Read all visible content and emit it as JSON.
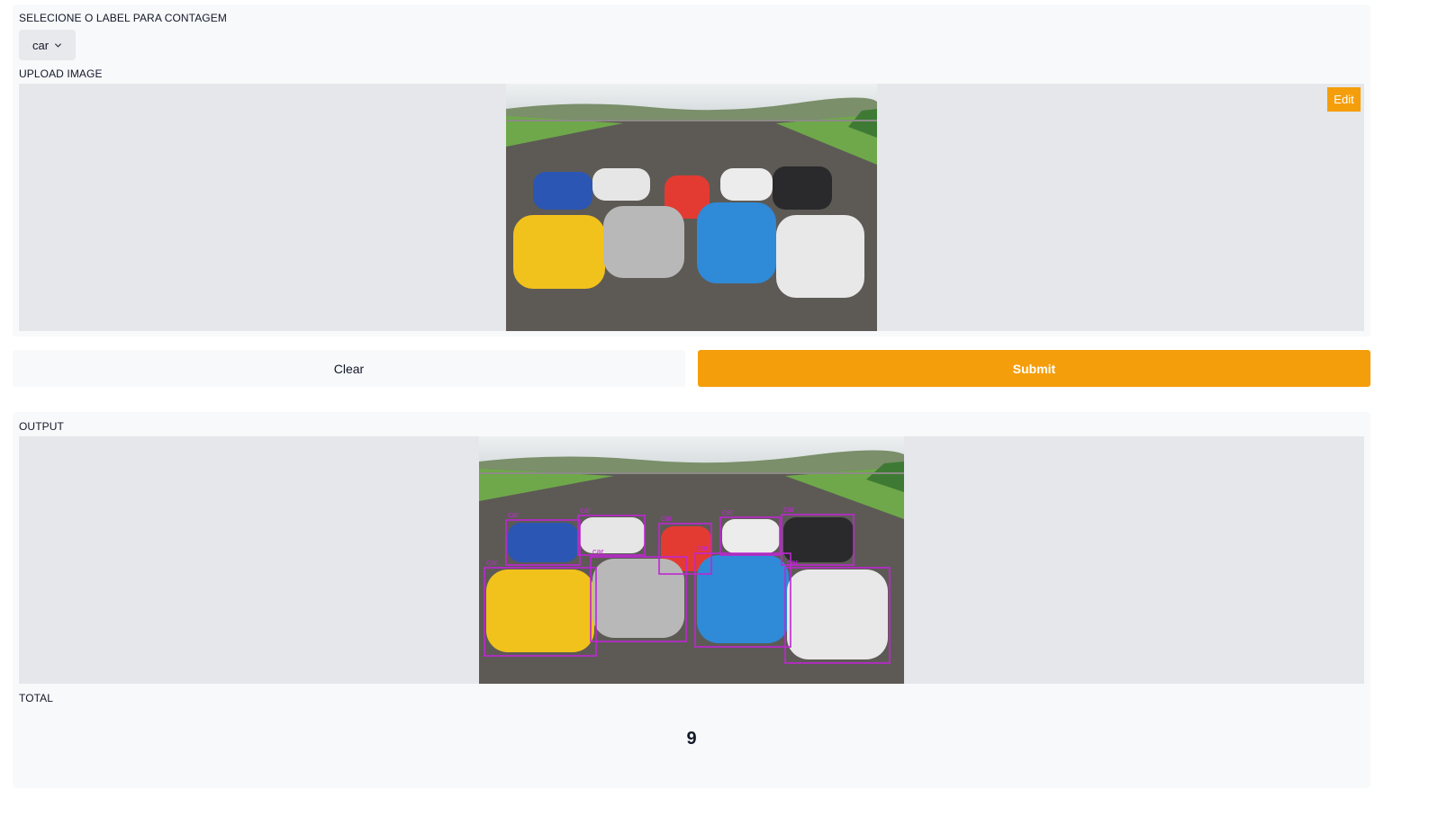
{
  "input": {
    "select_label": "SELECIONE O LABEL PARA CONTAGEM",
    "selected_value": "car",
    "upload_label": "UPLOAD IMAGE",
    "edit_label": "Edit"
  },
  "actions": {
    "clear_label": "Clear",
    "submit_label": "Submit"
  },
  "output": {
    "output_label": "OUTPUT",
    "total_label": "TOTAL",
    "total_value": "9",
    "detection_label": "car"
  },
  "colors": {
    "accent": "#f59e0b",
    "bbox": "#c026d3"
  },
  "icons": {
    "dropdown": "chevron-down-icon",
    "edit": "edit-button"
  }
}
